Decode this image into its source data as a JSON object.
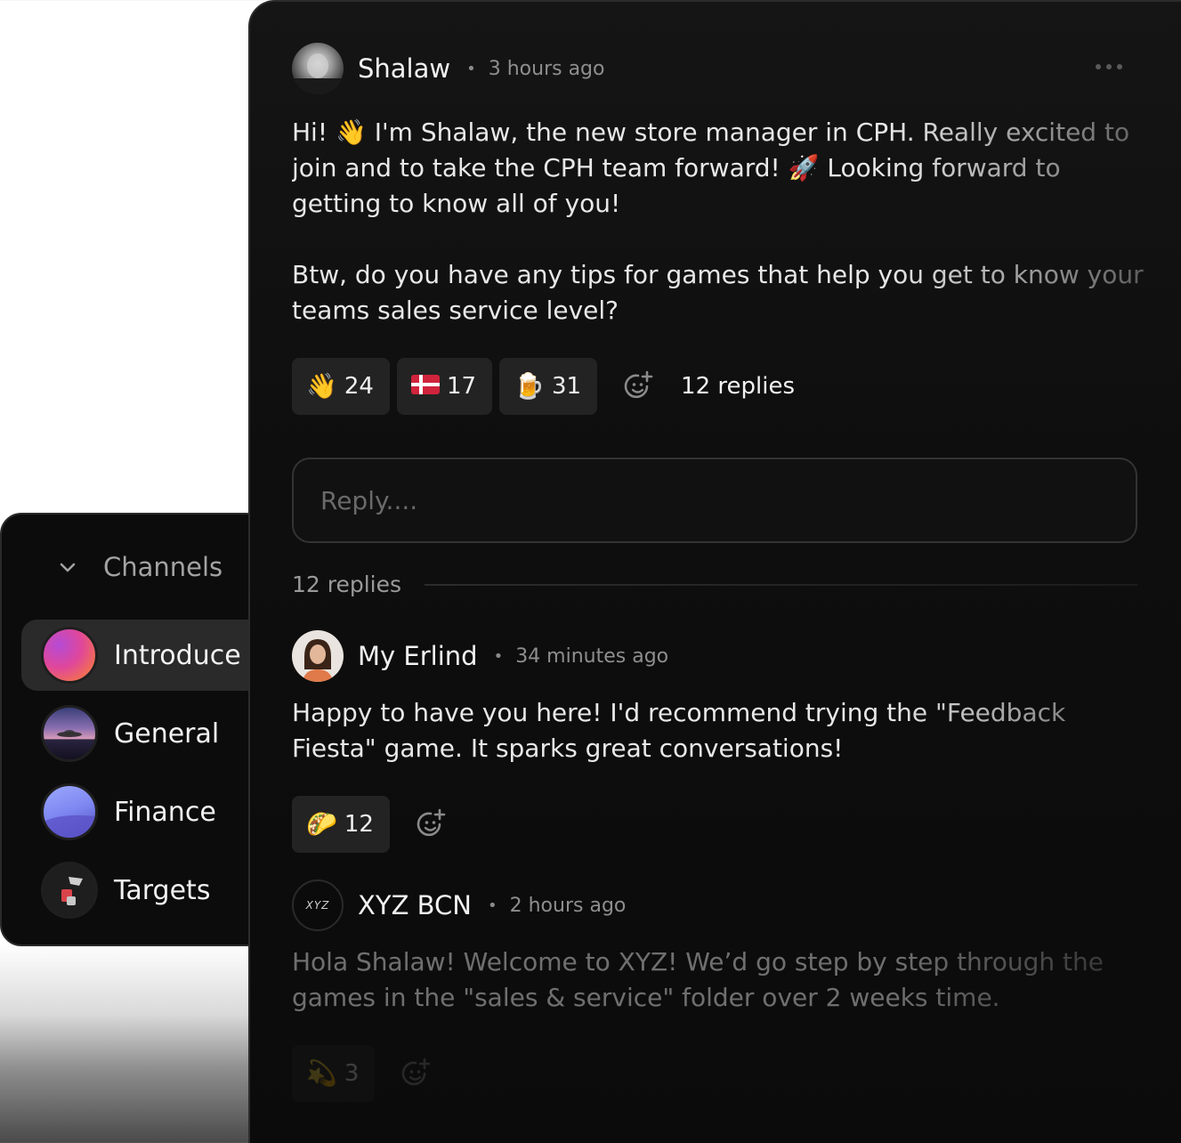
{
  "sidebar": {
    "header_label": "Channels",
    "channels": [
      {
        "label": "Introduce",
        "active": true
      },
      {
        "label": "General",
        "active": false
      },
      {
        "label": "Finance",
        "active": false
      },
      {
        "label": "Targets",
        "active": false
      }
    ]
  },
  "post": {
    "author": "Shalaw",
    "time": "3 hours ago",
    "body": "Hi! 👋 I'm Shalaw, the new store manager in CPH. Really excited to join and to take the CPH team forward! 🚀 Looking forward to getting to know all of you!\n\nBtw, do you have any tips for games that help you get to know your teams sales service level?",
    "reactions": [
      {
        "emoji": "👋",
        "count": "24"
      },
      {
        "emoji": "🇩🇰",
        "count": "17"
      },
      {
        "emoji": "🍺",
        "count": "31"
      }
    ],
    "replies_link": "12 replies"
  },
  "reply_box": {
    "placeholder": "Reply...."
  },
  "replies_divider": "12 replies",
  "replies": [
    {
      "author": "My Erlind",
      "time": "34 minutes ago",
      "body": "Happy to have you here! I'd recommend trying the \"Feedback Fiesta\" game. It sparks great conversations!",
      "reactions": [
        {
          "emoji": "🌮",
          "count": "12"
        }
      ]
    },
    {
      "author": "XYZ BCN",
      "avatar_text": "XYZ",
      "time": "2 hours ago",
      "body": "Hola Shalaw! Welcome to XYZ! We’d go step by step through the games in the \"sales & service\" folder over 2 weeks time.",
      "reactions": [
        {
          "emoji": "💫",
          "count": "3"
        }
      ]
    }
  ],
  "colors": {
    "panel_bg": "#0e0e0e",
    "reaction_bg": "#232323",
    "active_channel_bg": "#2a2a2a",
    "text_primary": "#f2f2f2",
    "text_muted": "#8e8e8e"
  }
}
